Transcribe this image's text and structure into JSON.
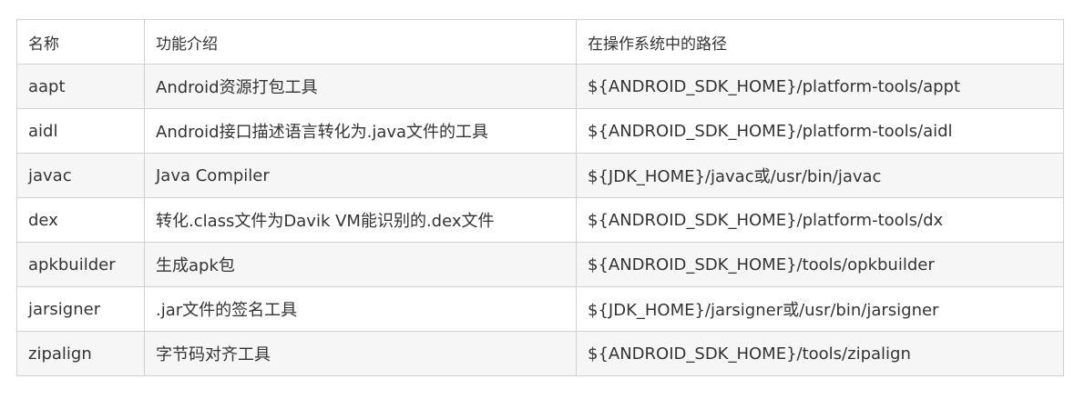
{
  "table": {
    "headers": [
      "名称",
      "功能介绍",
      "在操作系统中的路径"
    ],
    "rows": [
      {
        "name": "aapt",
        "desc": "Android资源打包工具",
        "path": "${ANDROID_SDK_HOME}/platform-tools/appt"
      },
      {
        "name": "aidl",
        "desc": "Android接口描述语言转化为.java文件的工具",
        "path": "${ANDROID_SDK_HOME}/platform-tools/aidl"
      },
      {
        "name": "javac",
        "desc": "Java Compiler",
        "path": "${JDK_HOME}/javac或/usr/bin/javac"
      },
      {
        "name": "dex",
        "desc": "转化.class文件为Davik VM能识别的.dex文件",
        "path": "${ANDROID_SDK_HOME}/platform-tools/dx"
      },
      {
        "name": "apkbuilder",
        "desc": "生成apk包",
        "path": "${ANDROID_SDK_HOME}/tools/opkbuilder"
      },
      {
        "name": "jarsigner",
        "desc": ".jar文件的签名工具",
        "path": "${JDK_HOME}/jarsigner或/usr/bin/jarsigner"
      },
      {
        "name": "zipalign",
        "desc": "字节码对齐工具",
        "path": "${ANDROID_SDK_HOME}/tools/zipalign"
      }
    ]
  }
}
